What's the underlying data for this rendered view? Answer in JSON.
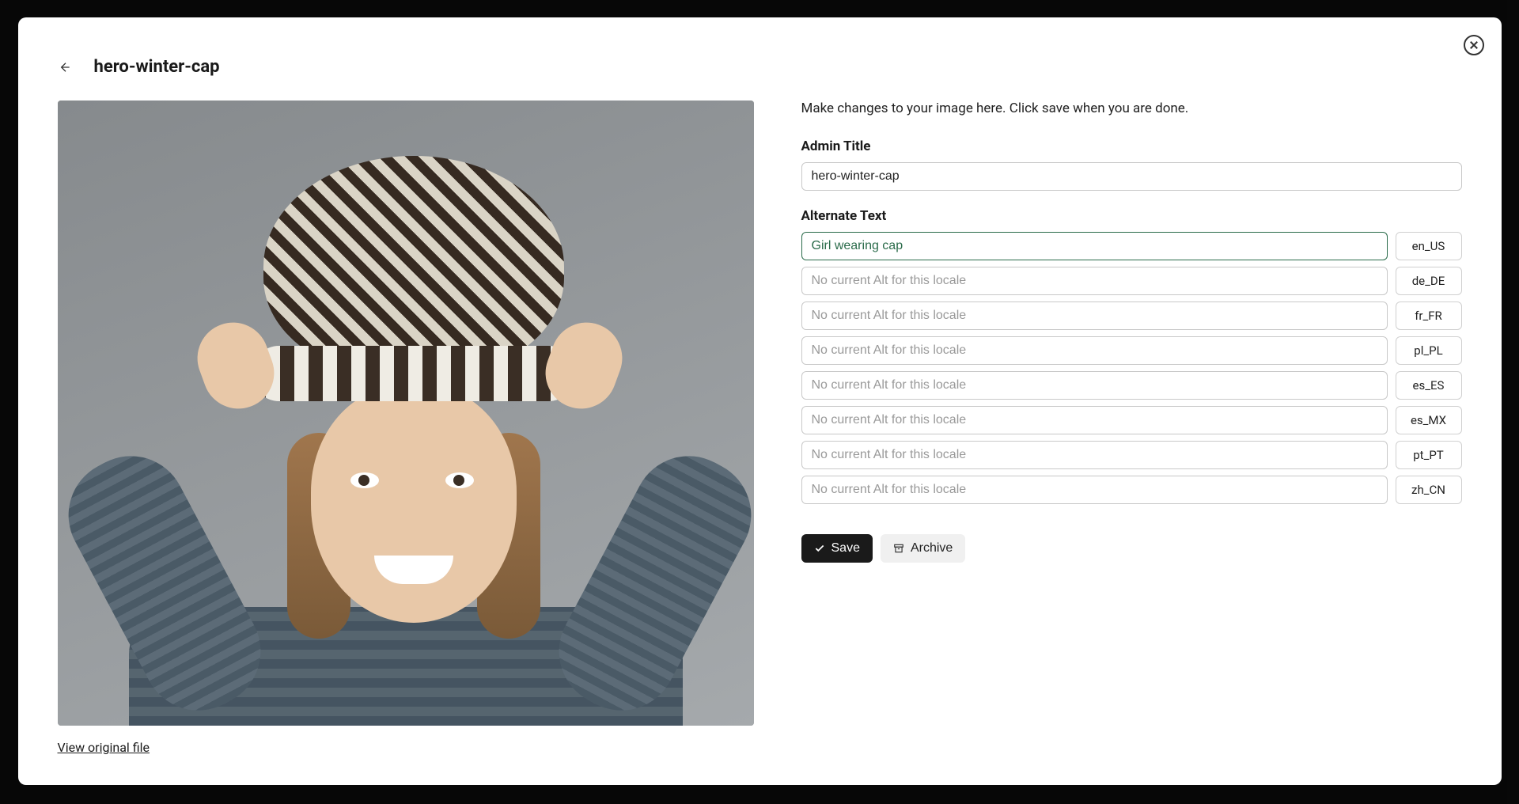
{
  "modal": {
    "title": "hero-winter-cap",
    "help_text": "Make changes to your image here. Click save when you are done.",
    "close_label": "Close"
  },
  "admin_title": {
    "label": "Admin Title",
    "value": "hero-winter-cap"
  },
  "alt_text": {
    "label": "Alternate Text",
    "placeholder_empty": "No current Alt for this locale",
    "rows": [
      {
        "value": "Girl wearing cap",
        "locale": "en_US",
        "filled": true
      },
      {
        "value": "",
        "locale": "de_DE",
        "filled": false
      },
      {
        "value": "",
        "locale": "fr_FR",
        "filled": false
      },
      {
        "value": "",
        "locale": "pl_PL",
        "filled": false
      },
      {
        "value": "",
        "locale": "es_ES",
        "filled": false
      },
      {
        "value": "",
        "locale": "es_MX",
        "filled": false
      },
      {
        "value": "",
        "locale": "pt_PT",
        "filled": false
      },
      {
        "value": "",
        "locale": "zh_CN",
        "filled": false
      }
    ]
  },
  "buttons": {
    "save": "Save",
    "archive": "Archive"
  },
  "links": {
    "view_original": "View original file"
  }
}
